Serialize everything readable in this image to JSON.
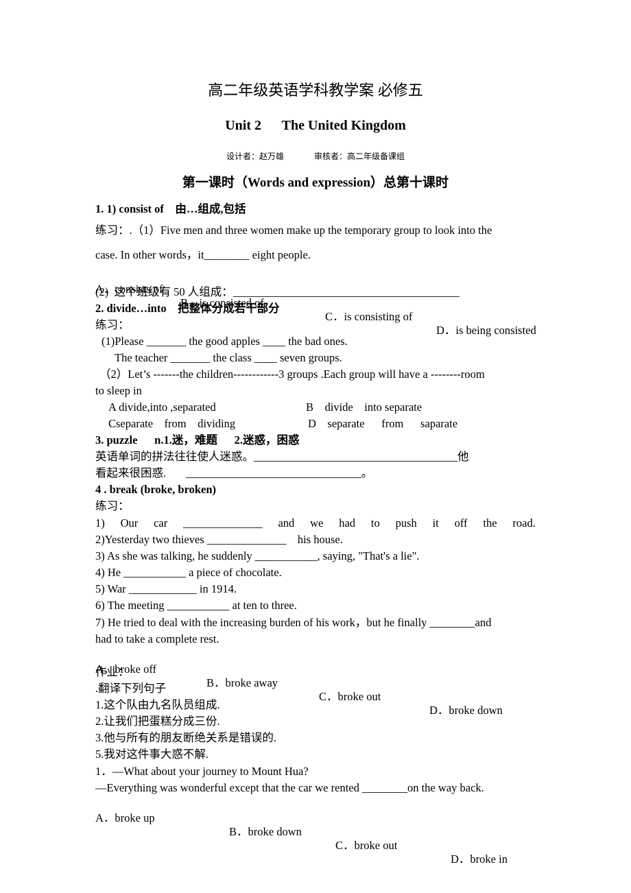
{
  "doc": {
    "title": "高二年级英语学科教学案 必修五",
    "unit": "Unit 2      The United Kingdom",
    "designer": "设计者：赵万雄",
    "reviewer": "审核者：高二年级备课组",
    "lesson": "第一课时（Words and expression）总第十课时"
  },
  "s1": {
    "heading": "1. 1) consist of    由…组成,包括",
    "q1_line1": "练习：.（1）Five men and three women make up the temporary group to look into the",
    "q1_line2": "case. In other words，it________ eight people.",
    "options": [
      "A．consists of",
      "B．is consisted of",
      "C．is consisting of",
      "D．is being consisted"
    ],
    "q2": "(2)  这个班级有 50 人组成：________________________________________"
  },
  "s2": {
    "heading": "2. divide…into    把整体分成若干部分",
    "practice": "练习：",
    "l1": "(1)Please _______ the good apples ____ the bad ones.",
    "l2": "The teacher _______ the class ____ seven groups.",
    "l3": "（2）Let’s -------the children------------3 groups .Each group will have a --------room",
    "l4": "to sleep in",
    "optA": "A divide,into ,separated",
    "optB": "B    divide    into separate",
    "optC": "Cseparate    from    dividing",
    "optD": "D    separate      from      saparate"
  },
  "s3": {
    "heading": "3. puzzle      n.1.迷，难题      2.迷惑，困惑",
    "l1": "英语单词的拼法往往使人迷惑。____________________________________他",
    "l2": "看起来很困惑.       _______________________________。"
  },
  "s4": {
    "heading": "4 . break (broke, broken)",
    "practice": "练习：",
    "q1_words": [
      "1)",
      "Our",
      "car",
      "______________",
      "and",
      "we",
      "had",
      "to",
      "push",
      "it",
      "off",
      "the",
      "road."
    ],
    "q2": "2)Yesterday two thieves ______________    his house.",
    "q3": "3) As she was talking, he suddenly ___________, saying, \"That's a lie\".",
    "q4": "4) He ___________ a piece of chocolate.",
    "q5": "5) War ____________ in 1914.",
    "q6": "6) The meeting ___________ at ten to three.",
    "q7_line1": "7) He tried to deal with the increasing burden of his work，but he finally ________and",
    "q7_line2": "had to take a complete rest.",
    "options": [
      "A．broke off",
      "B．broke away",
      "C．broke out",
      "D．broke down"
    ]
  },
  "homework": {
    "heading": "作业：",
    "translate": ".翻译下列句子",
    "items": [
      "1.这个队由九名队员组成.",
      "2.让我们把蛋糕分成三份.",
      "3.他与所有的朋友断绝关系是错误的.",
      "5.我对这件事大惑不解."
    ],
    "q1_line1": "1．—What about your journey to Mount Hua?",
    "q1_line2": "—Everything was wonderful except that the car we rented ________on the way back.",
    "options": [
      "A．broke up",
      "B．broke down",
      "C．broke out",
      "D．broke in"
    ]
  }
}
